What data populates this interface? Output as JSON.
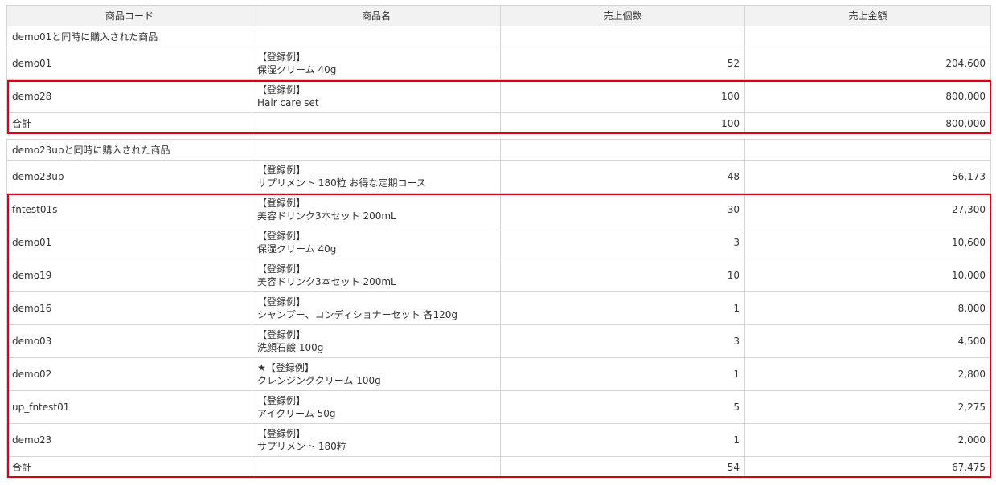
{
  "headers": {
    "code": "商品コード",
    "name": "商品名",
    "quantity": "売上個数",
    "amount": "売上金額"
  },
  "sections": [
    {
      "group_title": "demo01と同時に購入された商品",
      "base": {
        "code": "demo01",
        "name_line1": "【登録例】",
        "name_line2": "保湿クリーム 40g",
        "quantity": "52",
        "amount": "204,600"
      },
      "items": [
        {
          "code": "demo28",
          "name_line1": "【登録例】",
          "name_line2": "Hair care set",
          "quantity": "100",
          "amount": "800,000"
        }
      ],
      "total": {
        "label": "合計",
        "quantity": "100",
        "amount": "800,000"
      }
    },
    {
      "group_title": "demo23upと同時に購入された商品",
      "base": {
        "code": "demo23up",
        "name_line1": "【登録例】",
        "name_line2": "サプリメント 180粒 お得な定期コース",
        "quantity": "48",
        "amount": "56,173"
      },
      "items": [
        {
          "code": "fntest01s",
          "name_line1": "【登録例】",
          "name_line2": "美容ドリンク3本セット 200mL",
          "quantity": "30",
          "amount": "27,300"
        },
        {
          "code": "demo01",
          "name_line1": "【登録例】",
          "name_line2": "保湿クリーム 40g",
          "quantity": "3",
          "amount": "10,600"
        },
        {
          "code": "demo19",
          "name_line1": "【登録例】",
          "name_line2": "美容ドリンク3本セット 200mL",
          "quantity": "10",
          "amount": "10,000"
        },
        {
          "code": "demo16",
          "name_line1": "【登録例】",
          "name_line2": "シャンプー、コンディショナーセット 各120g",
          "quantity": "1",
          "amount": "8,000"
        },
        {
          "code": "demo03",
          "name_line1": "【登録例】",
          "name_line2": "洗顔石鹸 100g",
          "quantity": "3",
          "amount": "4,500"
        },
        {
          "code": "demo02",
          "name_line1": "★【登録例】",
          "name_line2": "クレンジングクリーム 100g",
          "quantity": "1",
          "amount": "2,800"
        },
        {
          "code": "up_fntest01",
          "name_line1": "【登録例】",
          "name_line2": "アイクリーム 50g",
          "quantity": "5",
          "amount": "2,275"
        },
        {
          "code": "demo23",
          "name_line1": "【登録例】",
          "name_line2": "サプリメント 180粒",
          "quantity": "1",
          "amount": "2,000"
        }
      ],
      "total": {
        "label": "合計",
        "quantity": "54",
        "amount": "67,475"
      }
    }
  ],
  "highlight_color": "#e00012"
}
